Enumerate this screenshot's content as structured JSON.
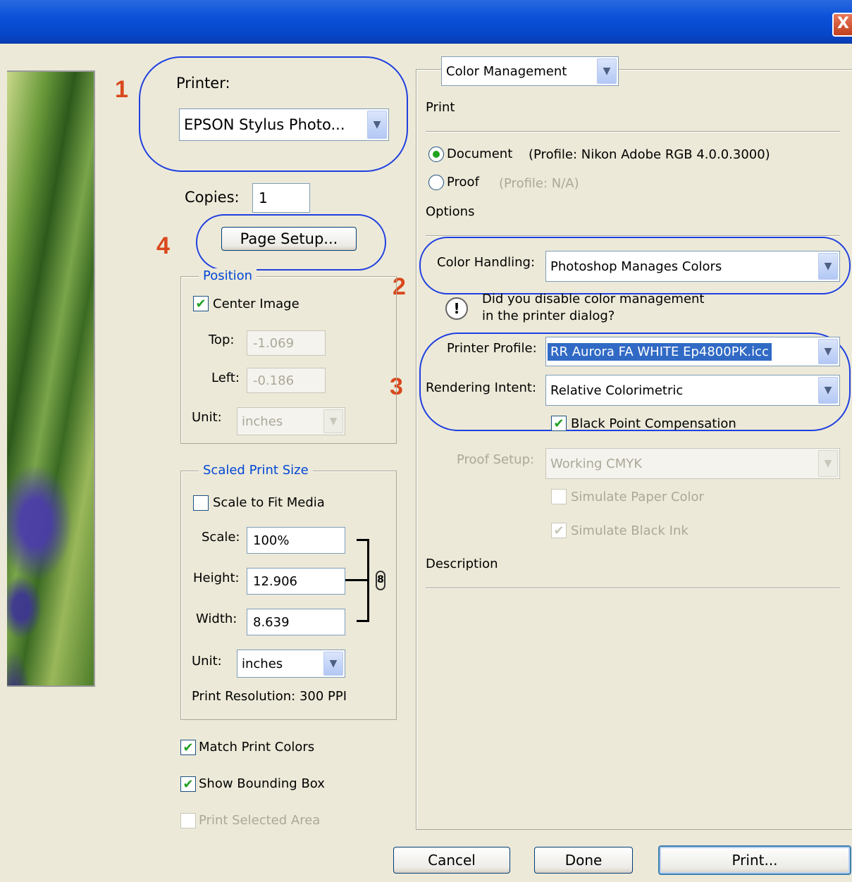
{
  "window": {
    "close_glyph": "X"
  },
  "printer": {
    "label": "Printer:",
    "value": "EPSON Stylus Photo..."
  },
  "copies": {
    "label": "Copies:",
    "value": "1"
  },
  "page_setup": {
    "label": "Page Setup..."
  },
  "position": {
    "legend": "Position",
    "center_image": {
      "label": "Center Image",
      "checked": true
    },
    "top": {
      "label": "Top:",
      "value": "-1.069"
    },
    "left": {
      "label": "Left:",
      "value": "-0.186"
    },
    "unit": {
      "label": "Unit:",
      "value": "inches"
    }
  },
  "scaled": {
    "legend": "Scaled Print Size",
    "scale_to_fit": {
      "label": "Scale to Fit Media",
      "checked": false
    },
    "scale": {
      "label": "Scale:",
      "value": "100%"
    },
    "height": {
      "label": "Height:",
      "value": "12.906"
    },
    "width": {
      "label": "Width:",
      "value": "8.639"
    },
    "unit": {
      "label": "Unit:",
      "value": "inches"
    },
    "resolution": "Print Resolution: 300 PPI"
  },
  "bottom_checks": {
    "match_print_colors": {
      "label": "Match Print Colors",
      "checked": true
    },
    "show_bounding_box": {
      "label": "Show Bounding Box",
      "checked": true
    },
    "print_selected_area": {
      "label": "Print Selected Area",
      "checked": false
    }
  },
  "right": {
    "mode": "Color Management",
    "print_header": "Print",
    "document": {
      "label": "Document",
      "profile": "(Profile: Nikon Adobe RGB 4.0.0.3000)",
      "selected": true
    },
    "proof": {
      "label": "Proof",
      "profile": "(Profile: N/A)",
      "selected": false
    },
    "options_header": "Options",
    "color_handling": {
      "label": "Color Handling:",
      "value": "Photoshop Manages Colors"
    },
    "warning": {
      "line1": "Did you disable color management",
      "line2": "in the printer dialog?"
    },
    "printer_profile": {
      "label": "Printer Profile:",
      "value": "RR Aurora FA WHITE Ep4800PK.icc"
    },
    "rendering_intent": {
      "label": "Rendering Intent:",
      "value": "Relative Colorimetric"
    },
    "black_point": {
      "label": "Black Point Compensation",
      "checked": true
    },
    "proof_setup": {
      "label": "Proof Setup:",
      "value": "Working CMYK"
    },
    "simulate_paper": {
      "label": "Simulate Paper Color",
      "checked": false
    },
    "simulate_black": {
      "label": "Simulate Black Ink",
      "checked": true
    },
    "description_header": "Description"
  },
  "buttons": {
    "cancel": "Cancel",
    "done": "Done",
    "print": "Print..."
  },
  "annotations": {
    "n1": "1",
    "n2": "2",
    "n3": "3",
    "n4": "4"
  },
  "glyphs": {
    "check": "✔",
    "chevron": "▼",
    "warning": "!",
    "link": "8"
  },
  "colors": {
    "annotation_number": "#d9481c",
    "annotation_ring": "#1e3fe0",
    "legend_blue": "#0046d5",
    "selection": "#316ac5"
  }
}
